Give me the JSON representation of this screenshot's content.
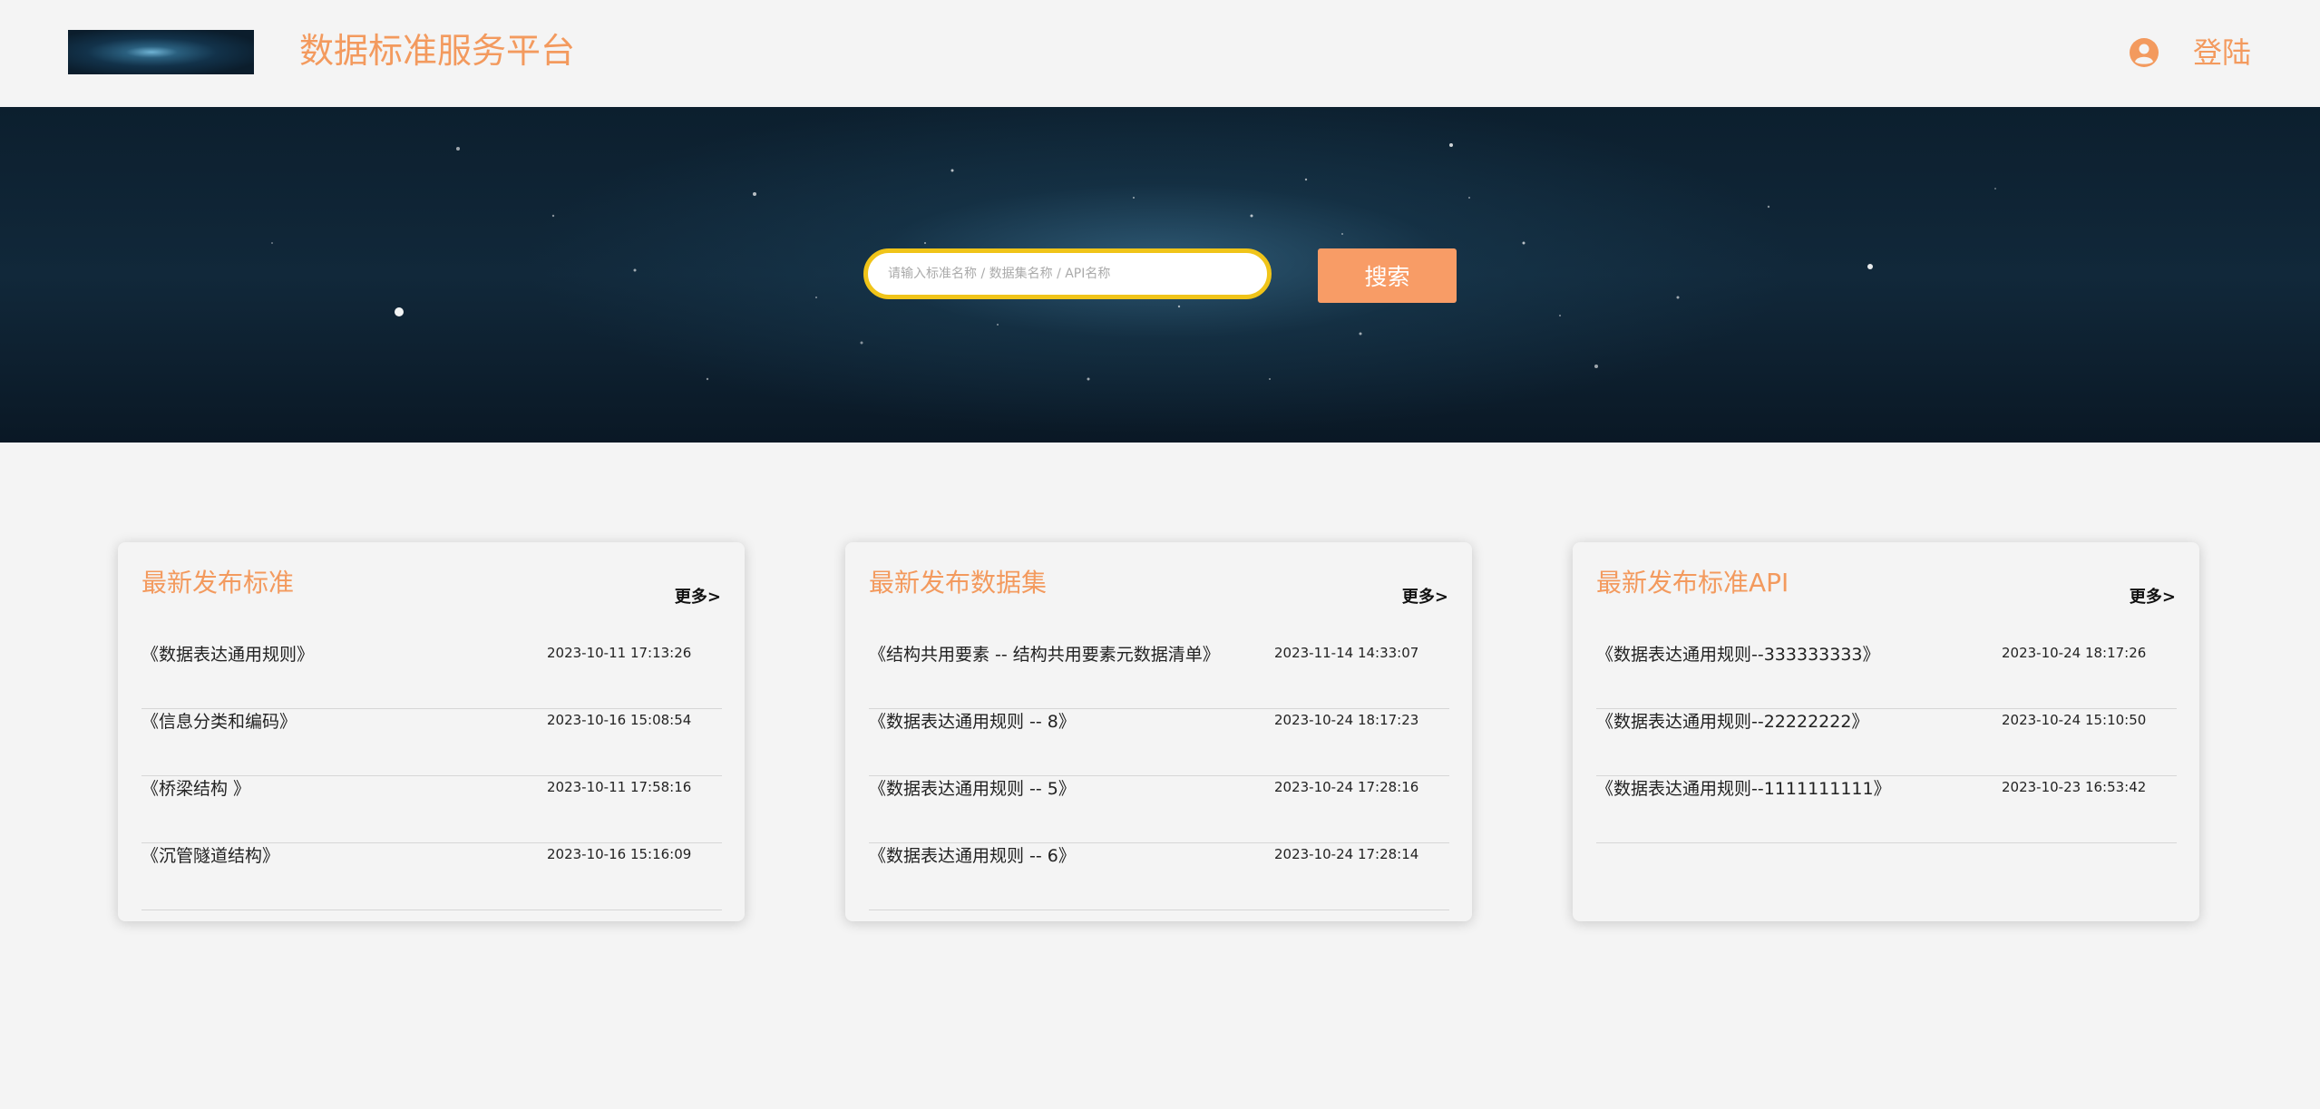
{
  "header": {
    "site_title": "数据标准服务平台",
    "login_label": "登陆",
    "accent_color": "#f39a5e"
  },
  "search": {
    "placeholder": "请输入标准名称 / 数据集名称 / API名称",
    "button_label": "搜索"
  },
  "cards": [
    {
      "title": "最新发布标准",
      "more_label": "更多>",
      "items": [
        {
          "title": "《数据表达通用规则》",
          "date": "2023-10-11 17:13:26"
        },
        {
          "title": "《信息分类和编码》",
          "date": "2023-10-16 15:08:54"
        },
        {
          "title": "《桥梁结构 》",
          "date": "2023-10-11 17:58:16"
        },
        {
          "title": "《沉管隧道结构》",
          "date": "2023-10-16 15:16:09"
        }
      ]
    },
    {
      "title": "最新发布数据集",
      "more_label": "更多>",
      "items": [
        {
          "title": "《结构共用要素 -- 结构共用要素元数据清单》",
          "date": "2023-11-14 14:33:07"
        },
        {
          "title": "《数据表达通用规则 -- 8》",
          "date": "2023-10-24 18:17:23"
        },
        {
          "title": "《数据表达通用规则 -- 5》",
          "date": "2023-10-24 17:28:16"
        },
        {
          "title": "《数据表达通用规则 -- 6》",
          "date": "2023-10-24 17:28:14"
        }
      ]
    },
    {
      "title": "最新发布标准API",
      "more_label": "更多>",
      "items": [
        {
          "title": "《数据表达通用规则--333333333》",
          "date": "2023-10-24 18:17:26"
        },
        {
          "title": "《数据表达通用规则--22222222》",
          "date": "2023-10-24 15:10:50"
        },
        {
          "title": "《数据表达通用规则--1111111111》",
          "date": "2023-10-23 16:53:42"
        }
      ]
    }
  ]
}
